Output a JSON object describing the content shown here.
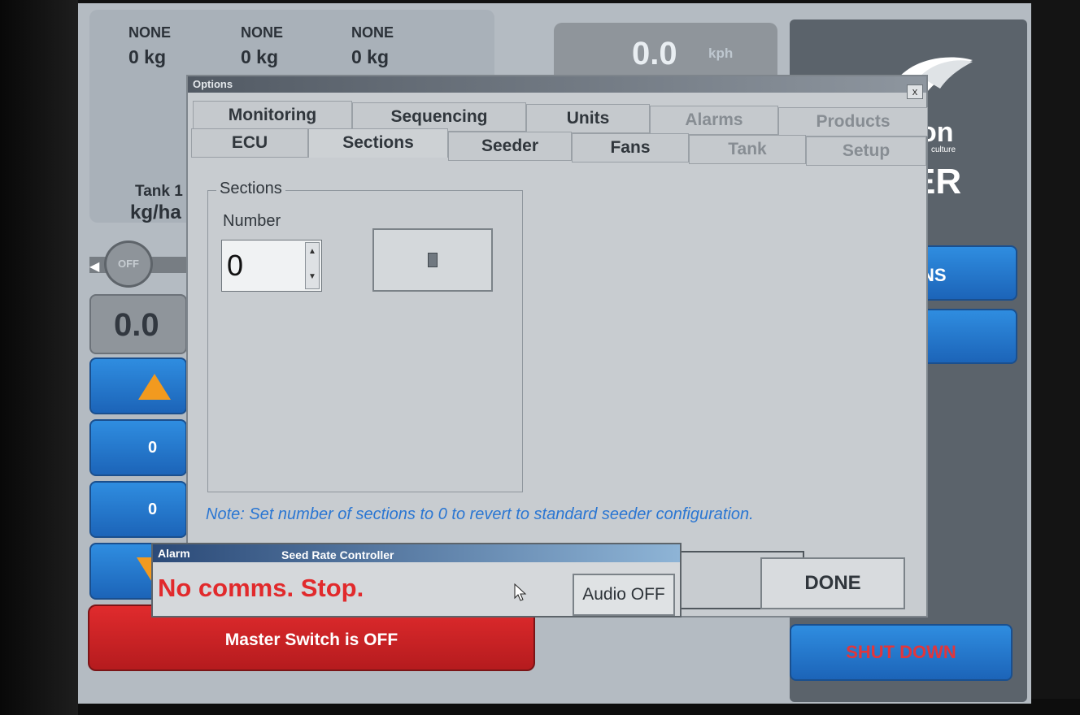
{
  "bins": [
    {
      "product": "NONE",
      "weight": "0 kg"
    },
    {
      "product": "NONE",
      "weight": "0 kg"
    },
    {
      "product": "NONE",
      "weight": "0 kg"
    }
  ],
  "tank": {
    "label": "Tank 1",
    "unit": "kg/ha"
  },
  "speed": {
    "value": "0.0",
    "unit": "kph"
  },
  "off_switch_label": "OFF",
  "rate_value": "0.0",
  "left_buttons": {
    "value_a": "0",
    "value_b": "0"
  },
  "master_switch_label": "Master Switch is OFF",
  "brand": {
    "line1": "on",
    "line2": "culture",
    "line3": "ER"
  },
  "right_buttons": {
    "b1": "NS",
    "b2": "",
    "shutdown": "SHUT DOWN"
  },
  "options": {
    "title": "Options",
    "close": "x",
    "tabs_row1": [
      "Monitoring",
      "Sequencing",
      "Units",
      "Alarms",
      "Products"
    ],
    "tabs_row2": [
      "ECU",
      "Sections",
      "Seeder",
      "Fans",
      "Tank",
      "Setup"
    ],
    "active_tab": "Sections",
    "group_label": "Sections",
    "number_label": "Number",
    "number_value": "0",
    "note": "Note: Set number of sections to 0 to revert to standard seeder configuration.",
    "done": "DONE"
  },
  "alarm": {
    "title": "Alarm",
    "subtitle": "Seed Rate Controller",
    "message": "No comms. Stop.",
    "audio_button": "Audio OFF"
  },
  "colors": {
    "accent_blue": "#2f8de0",
    "alarm_red": "#e12a2c",
    "note_blue": "#2a76d2",
    "arrow_orange": "#f29a1f"
  }
}
